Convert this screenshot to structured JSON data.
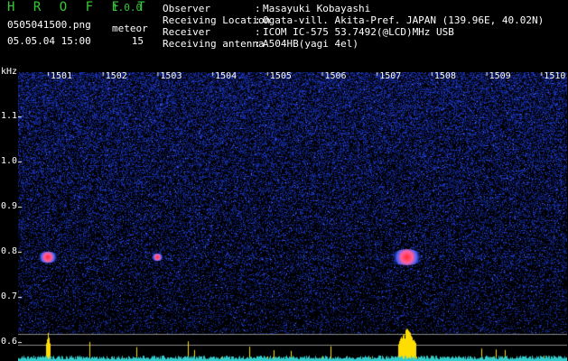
{
  "header": {
    "app_name": "H R O F F T",
    "app_version": "1.0.0",
    "file_name": "0505041500.png",
    "datetime": "05.05.04 15:00",
    "meteor_label": "meteor",
    "meteor_count": "15",
    "fields": [
      {
        "label": "Observer",
        "value": "Masayuki Kobayashi"
      },
      {
        "label": "Receiving Location",
        "value": "Ogata-vill. Akita-Pref. JAPAN (139.96E, 40.02N)"
      },
      {
        "label": "Receiver",
        "value": "ICOM IC-575 53.7492(@LCD)MHz USB"
      },
      {
        "label": "Receiving antenna",
        "value": "A504HB(yagi 4el)"
      }
    ]
  },
  "axis": {
    "y_unit": "kHz",
    "y_ticks": [
      "1.1",
      "1.0",
      "0.9",
      "0.8",
      "0.7",
      "0.6"
    ],
    "x_ticks": [
      "1501",
      "1502",
      "1503",
      "1504",
      "1505",
      "1506",
      "1507",
      "1508",
      "1509",
      "1510"
    ]
  },
  "colors": {
    "background": "#000000",
    "spectrum_noise": "#1a2a9a",
    "axis_text": "#ffffff",
    "title_green": "#33cc33",
    "echo_red": "#ff3030",
    "signal_line": "#ffdd00",
    "baseline": "#33cccc"
  },
  "echoes": [
    {
      "minute": 1501.0,
      "khz": 0.79,
      "strength": 0.55
    },
    {
      "minute": 1507.55,
      "khz": 0.79,
      "strength": 1.0
    },
    {
      "minute": 1503.0,
      "khz": 0.79,
      "strength": 0.2
    }
  ]
}
